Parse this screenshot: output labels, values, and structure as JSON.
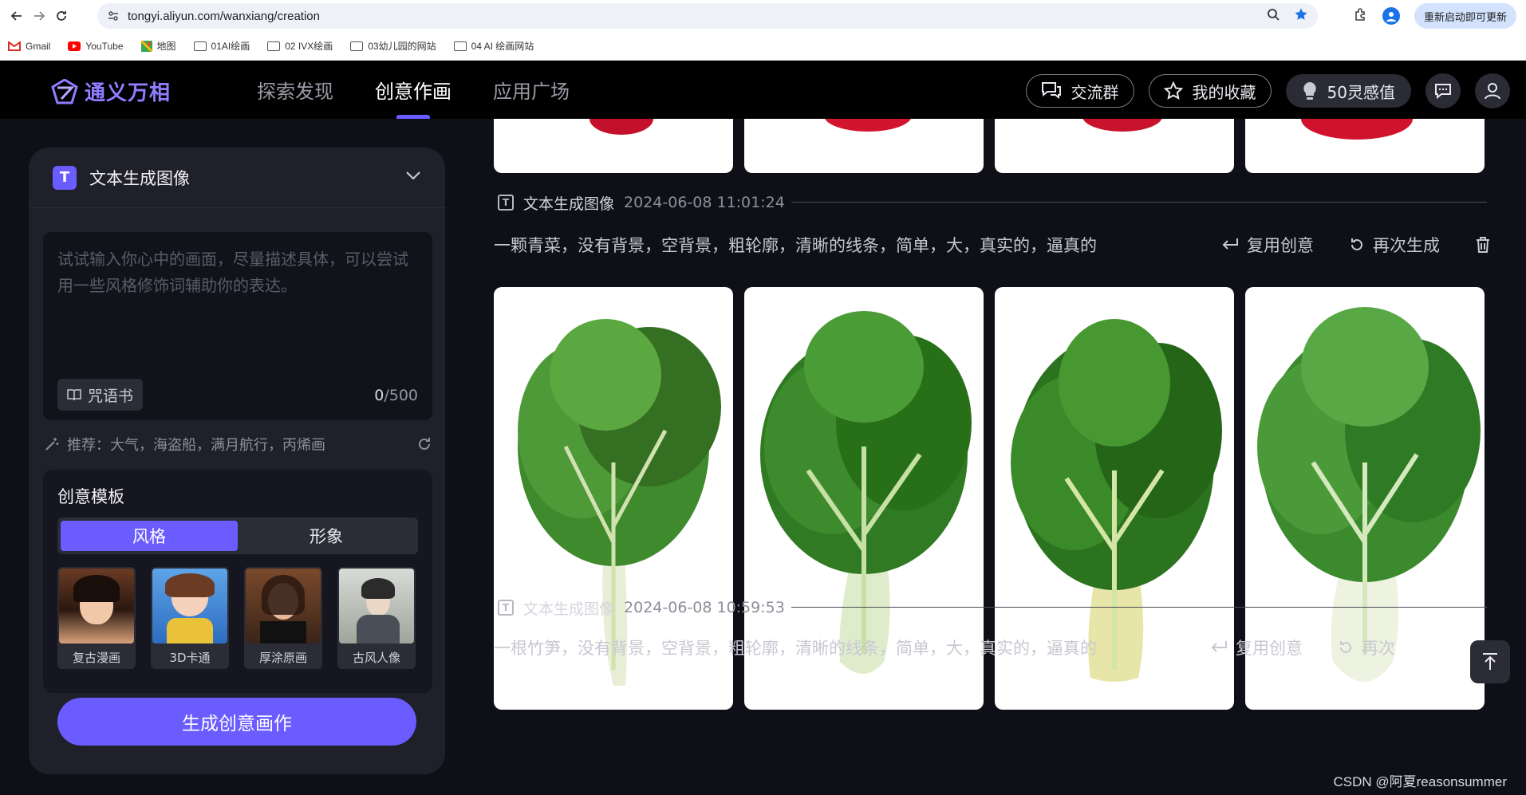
{
  "browser": {
    "url": "tongyi.aliyun.com/wanxiang/creation",
    "update_label": "重新启动即可更新",
    "bookmarks": [
      {
        "label": "Gmail",
        "icon": "gmail-icon"
      },
      {
        "label": "YouTube",
        "icon": "youtube-icon"
      },
      {
        "label": "地图",
        "icon": "maps-icon"
      },
      {
        "label": "01AI绘画",
        "icon": "folder-icon"
      },
      {
        "label": "02 IVX绘画",
        "icon": "folder-icon"
      },
      {
        "label": "03幼儿园的网站",
        "icon": "folder-icon"
      },
      {
        "label": "04 AI 绘画网站",
        "icon": "folder-icon"
      }
    ]
  },
  "app": {
    "name": "通义万相",
    "nav": [
      "探索发现",
      "创意作画",
      "应用广场"
    ],
    "active_nav": "创意作画",
    "actions": {
      "group": "交流群",
      "favorites": "我的收藏",
      "points": "50灵感值"
    },
    "accent_color": "#6b5cff"
  },
  "left_panel": {
    "mode_title": "文本生成图像",
    "prompt_placeholder": "试试输入你心中的画面，尽量描述具体，可以尝试用一些风格修饰词辅助你的表达。",
    "spell_book_label": "咒语书",
    "char_count_current": "0",
    "char_count_max": "/500",
    "suggest": "推荐：大气，海盗船，满月航行，丙烯画",
    "template_title": "创意模板",
    "tabs": [
      "风格",
      "形象"
    ],
    "active_tab": "风格",
    "styles": [
      "复古漫画",
      "3D卡通",
      "厚涂原画",
      "古风人像"
    ],
    "generate_label": "生成创意画作"
  },
  "feed": [
    {
      "type": "文本生成图像",
      "time": "2024-06-08 11:01:24",
      "prompt": "一颗青菜，没有背景，空背景，粗轮廓，清晰的线条，简单，大，真实的，逼真的",
      "reuse_label": "复用创意",
      "regen_label": "再次生成",
      "image_count": 4
    },
    {
      "type": "文本生成图像",
      "time": "2024-06-08 10:59:53",
      "prompt": "一根竹笋，没有背景，空背景，粗轮廓，清晰的线条，简单，大，真实的，逼真的",
      "reuse_label": "复用创意",
      "regen_label": "再次"
    }
  ],
  "watermark": "CSDN @阿夏reasonsummer"
}
